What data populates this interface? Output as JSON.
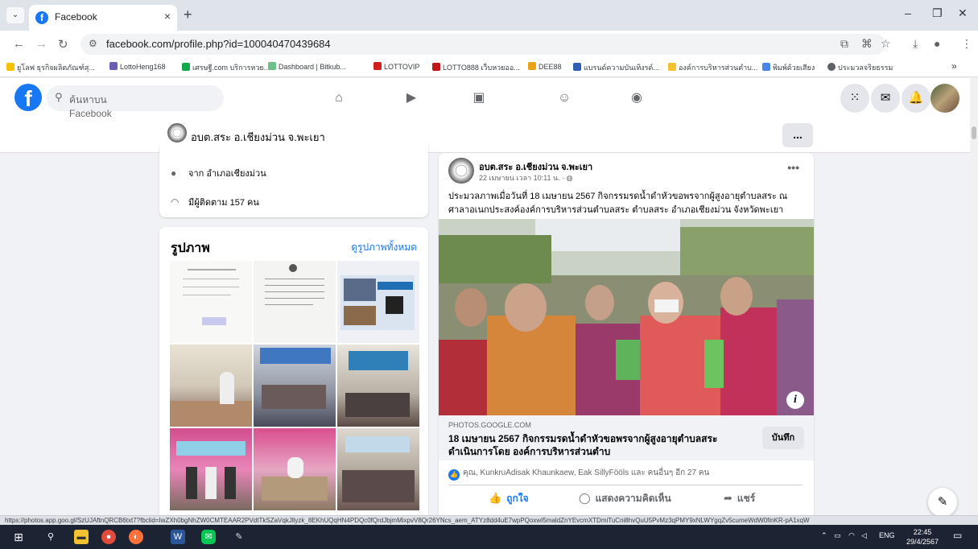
{
  "browser": {
    "tab_title": "Facebook",
    "url": "facebook.com/profile.php?id=100040470439684",
    "bookmarks": [
      {
        "label": "ยูโลฟ ธุรกิจผลิตภัณฑ์สุ...",
        "color": "#f5c400"
      },
      {
        "label": "LottoHeng168",
        "color": "#6b5fb5"
      },
      {
        "label": "เศรษฐี.com บริการหวย...",
        "color": "#12a84c"
      },
      {
        "label": "Dashboard | Bitkub...",
        "color": "#6fbf8a"
      },
      {
        "label": "LOTTOVIP",
        "color": "#d0211c"
      },
      {
        "label": "LOTTO888 เว็บหวยออ...",
        "color": "#c4161c"
      },
      {
        "label": "DEE88",
        "color": "#e8a317"
      },
      {
        "label": "แบรนด์ความบันเทิงรด์...",
        "color": "#2f5fb3"
      },
      {
        "label": "องค์การบริหารส่วนตำบ...",
        "color": "#f2c230"
      },
      {
        "label": "พิมพ์ด้วยเสียง",
        "color": "#4a86e8"
      },
      {
        "label": "ประมวลจริยธรรม",
        "color": "#5f6368"
      }
    ],
    "bookmarks_overflow": "»",
    "status_url": "https://photos.app.goo.gl/SzUJAftnQRCB6txt7?fbclid=IwZXh0bgNhZW0CMTEAAR2PVdtTkSZaVqkJllyzk_8EKhUQqHN4PDQc0fQrdJbjmMixpvV8Qr26YNcs_aem_ATYz8dd4uE7wpPQoxwI5maldZnYEvcmXTDmiTuCni8hvQuU5PvMz3qPMY9xNLWYgqZv5cumeWdW0finKR-pA1xqW"
  },
  "facebook": {
    "search_placeholder": "ค้นหาบน Facebook",
    "page_name": "อบต.สระ อ.เชียงม่วน จ.พะเยา",
    "more_label": "...",
    "intro": {
      "location": "จาก อำเภอเชียงม่วน",
      "followers": "มีผู้ติดตาม 157 คน"
    },
    "photos": {
      "title": "รูปภาพ",
      "see_all": "ดูรูปภาพทั้งหมด"
    },
    "post": {
      "author": "อบต.สระ อ.เชียงม่วน จ.พะเยา",
      "time": "22 เมษายน เวลา 10:11 น. · ",
      "text_line1": "ประมวลภาพเมื่อวันที่ 18 เมษายน 2567 กิจกรรมรดน้ำดำหัวขอพรจากผู้สูงอายุตำบลสระ ณ",
      "text_line2": "ศาลาอเนกประสงค์องค์การบริหารส่วนตำบลสระ ตำบลสระ อำเภอเชียงม่วน จังหวัดพะเยา",
      "link_domain": "PHOTOS.GOOGLE.COM",
      "link_title": "18 เมษายน 2567 กิจกรรมรดน้ำดำหัวขอพรจากผู้สูงอายุตำบลสระ ดำเนินการโดย องค์การบริหารส่วนตำบ",
      "save_label": "บันทึก",
      "reactions": "คุณ, KunkruAdisak Khaunkaew, Eak SillyFööls และ คนอื่นๆ อีก 27 คน",
      "actions": {
        "like": "ถูกใจ",
        "comment": "แสดงความคิดเห็น",
        "share": "แชร์"
      }
    }
  },
  "taskbar": {
    "language": "ENG",
    "time": "22:45",
    "date": "29/4/2567"
  },
  "colors": {
    "fb_blue": "#1877f2",
    "taskbar": "#1c2434"
  }
}
